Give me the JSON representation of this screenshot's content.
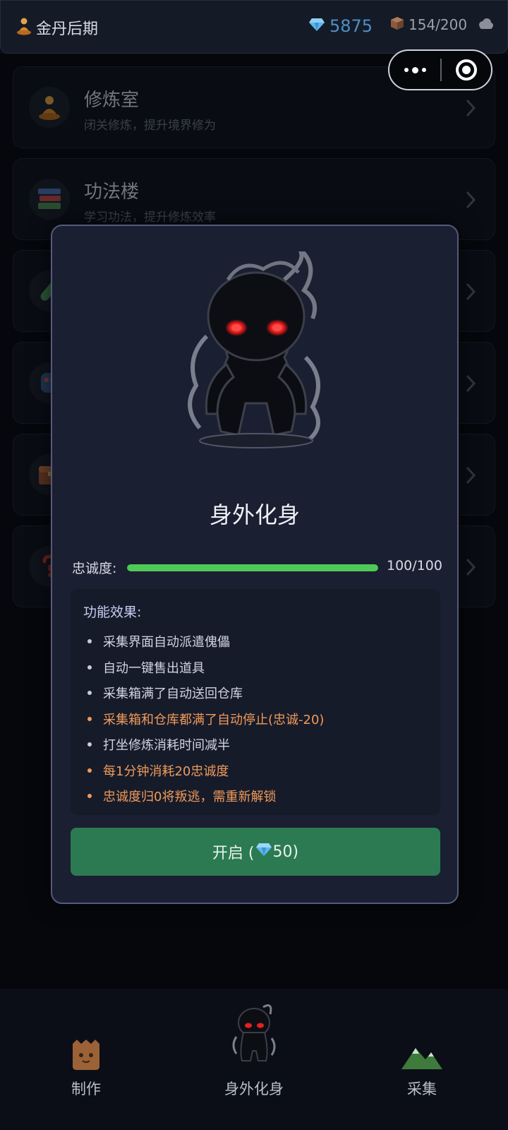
{
  "header": {
    "realm": "金丹后期",
    "gems": "5875",
    "storage": "154/200"
  },
  "colors": {
    "accent": "#2b7a52",
    "progress": "#4fca57",
    "warning": "#f09a5a",
    "gem": "#4d8fc8"
  },
  "list": [
    {
      "title": "修炼室",
      "desc": "闭关修炼，提升境界修为",
      "icon": "meditation-icon"
    },
    {
      "title": "功法楼",
      "desc": "学习功法，提升修炼效率",
      "icon": "books-icon"
    },
    {
      "title": "",
      "desc": "",
      "icon": "potion-icon"
    },
    {
      "title": "",
      "desc": "",
      "icon": "puppet-icon"
    },
    {
      "title": "",
      "desc": "",
      "icon": "chest-icon"
    },
    {
      "title": "",
      "desc": "",
      "icon": "question-icon"
    }
  ],
  "modal": {
    "title": "身外化身",
    "loyalty_label": "忠诚度:",
    "loyalty_value": "100/100",
    "loyalty_fraction": 1.0,
    "effects_title": "功能效果:",
    "effects": [
      {
        "text": "采集界面自动派遣傀儡",
        "warn": false
      },
      {
        "text": "自动一键售出道具",
        "warn": false
      },
      {
        "text": "采集箱满了自动送回仓库",
        "warn": false
      },
      {
        "text": "采集箱和仓库都满了自动停止(忠诚-20)",
        "warn": true
      },
      {
        "text": "打坐修炼消耗时间减半",
        "warn": false
      },
      {
        "text": "每1分钟消耗20忠诚度",
        "warn": true
      },
      {
        "text": "忠诚度归0将叛逃，需重新解锁",
        "warn": true
      }
    ],
    "button_prefix": "开启 (",
    "button_cost": "50)"
  },
  "tabs": [
    {
      "label": "制作",
      "icon": "wood-golem-icon"
    },
    {
      "label": "身外化身",
      "icon": "shadow-avatar-icon"
    },
    {
      "label": "采集",
      "icon": "mountain-icon"
    }
  ]
}
